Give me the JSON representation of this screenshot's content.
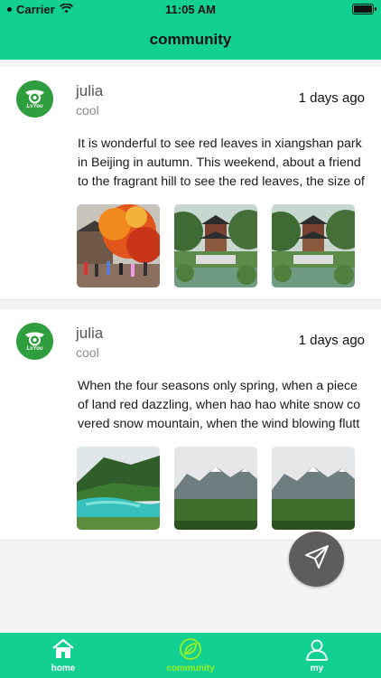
{
  "status_bar": {
    "carrier": "Carrier",
    "time": "11:05 AM",
    "icons": [
      "wifi-icon",
      "battery-icon"
    ]
  },
  "nav": {
    "title": "community"
  },
  "theme": {
    "primary": "#11d092",
    "active_tab": "#9cf01d",
    "fab": "#5d5d5d"
  },
  "posts": [
    {
      "username": "julia",
      "signature": "cool",
      "time_ago": "1 days ago",
      "avatar_text": "LvYou",
      "content": "It is wonderful to see red leaves in xiangshan park in Beijing in autumn. This weekend, about a friend to the fragrant hill to see the red leaves, the size of the scale, but also really many, simply",
      "photos": [
        "autumn-maple-photo",
        "chinese-pavilion-photo",
        "chinese-pavilion-photo"
      ]
    },
    {
      "username": "julia",
      "signature": "cool",
      "time_ago": "1 days ago",
      "avatar_text": "LvYou",
      "content": "When the four seasons only spring, when a piece of land red dazzling, when hao hao white snow covered snow mountain, when the wind blowing fluttering prayer flags, when the clouds in th",
      "photos": [
        "turquoise-lake-photo",
        "snow-mountain-photo",
        "snow-mountain-photo"
      ]
    }
  ],
  "fab": {
    "icon": "paper-plane-icon"
  },
  "tabs": [
    {
      "label": "home",
      "icon": "home-icon"
    },
    {
      "label": "community",
      "icon": "leaf-icon"
    },
    {
      "label": "my",
      "icon": "user-icon"
    }
  ]
}
